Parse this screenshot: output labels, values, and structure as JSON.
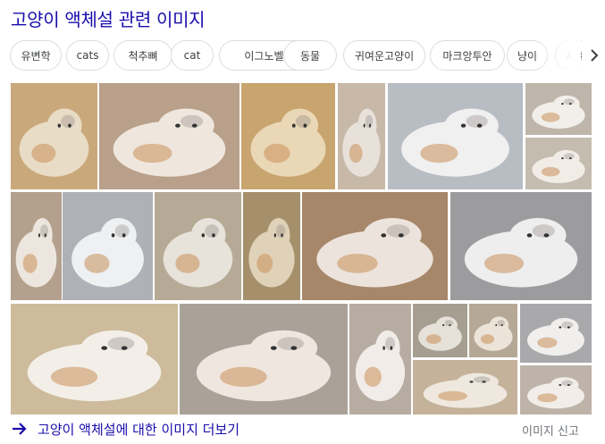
{
  "section_title": "고양이 액체설 관련 이미지",
  "chips": [
    "유변학",
    "cats",
    "척추뼈",
    "cat",
    "이그노벨상",
    "동물",
    "귀여운고양이",
    "마크앙투안",
    "냥이",
    "세계"
  ],
  "footer": {
    "more_label": "고양이 액체설에 대한 이미지 더보기",
    "report_label": "이미지 신고"
  },
  "colors": {
    "link": "#1a0dab",
    "chip_border": "#dadce0",
    "muted_text": "#70757a"
  },
  "icons": {
    "next": "chevron-right-icon",
    "more": "arrow-right-icon"
  }
}
